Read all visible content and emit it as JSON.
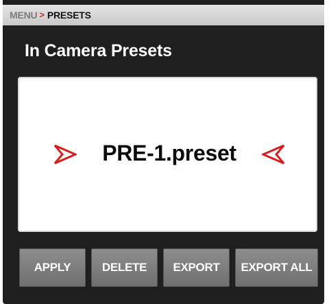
{
  "breadcrumb": {
    "menu": "MENU",
    "separator": ">",
    "current": "PRESETS"
  },
  "page": {
    "title": "In Camera Presets"
  },
  "preset": {
    "name": "PRE-1.preset",
    "prev_icon": "chevron-right-icon",
    "next_icon": "chevron-left-icon"
  },
  "buttons": {
    "apply": "APPLY",
    "delete": "DELETE",
    "export": "EXPORT",
    "export_all": "EXPORT ALL"
  },
  "colors": {
    "background": "#1f1f1f",
    "accent_red": "#d51f1f",
    "button_gray": "#7e7e7e",
    "breadcrumb_bar": "#d6d6d6"
  }
}
